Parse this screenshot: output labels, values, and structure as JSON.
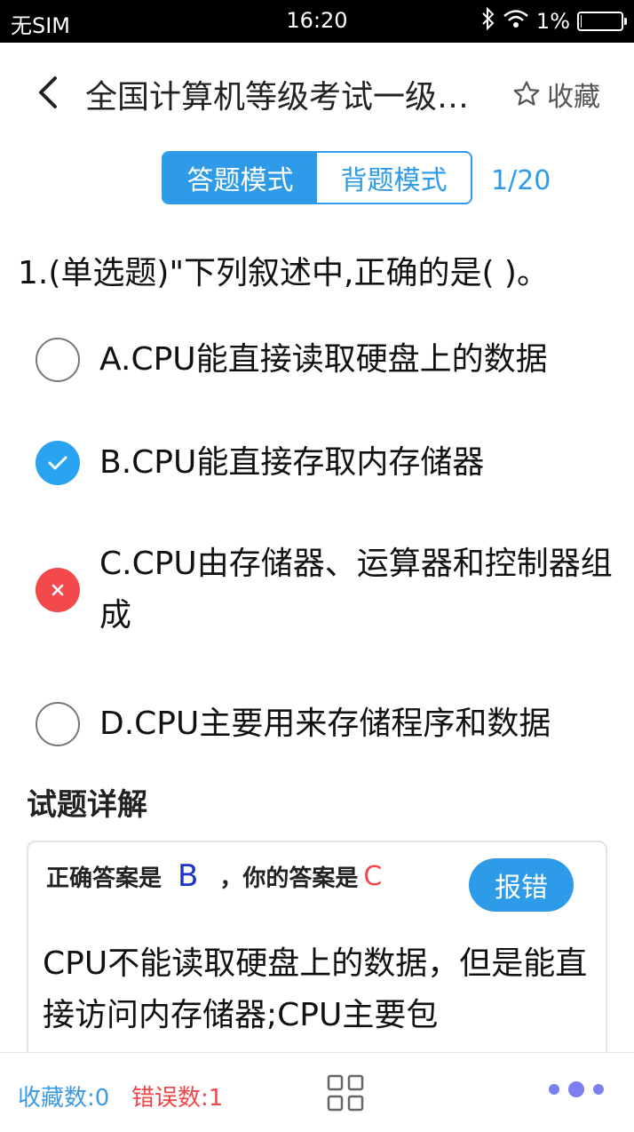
{
  "status_bar": {
    "carrier": "无SIM",
    "time": "16:20",
    "battery_text": "1%",
    "battery_level": 0.01,
    "bluetooth_icon": "bluetooth-icon",
    "wifi_icon": "wifi-icon"
  },
  "nav": {
    "back_icon": "chevron-left-icon",
    "title": "全国计算机等级考试一级…",
    "favorite_icon": "star-outline-icon",
    "favorite_label": "收藏"
  },
  "mode": {
    "answer_mode": "答题模式",
    "recite_mode": "背题模式",
    "active": "answer_mode"
  },
  "progress": "1/20",
  "question": {
    "text": "1.(单选题)\"下列叙述中,正确的是( )。",
    "options": [
      {
        "text": "A.CPU能直接读取硬盘上的数据",
        "state": "empty"
      },
      {
        "text": "B.CPU能直接存取内存储器",
        "state": "correct"
      },
      {
        "text": "C.CPU由存储器、运算器和控制器组成",
        "state": "wrong"
      },
      {
        "text": "D.CPU主要用来存储程序和数据",
        "state": "empty"
      }
    ]
  },
  "detail": {
    "title": "试题详解",
    "correct_label": "正确答案是",
    "correct_value": "B",
    "your_label": "，你的答案是",
    "your_value": "C",
    "report_button": "报错",
    "explanation": "CPU不能读取硬盘上的数据，但是能直接访问内存储器;CPU主要包"
  },
  "bottom": {
    "favorite_count": "收藏数:0",
    "error_count": "错误数:1",
    "grid_icon": "grid-icon",
    "more_icon": "more-dots-icon"
  },
  "colors": {
    "accent": "#2e9be8",
    "correct": "#2aa3f0",
    "wrong": "#f2494c",
    "answer_blue": "#1a33c8"
  }
}
